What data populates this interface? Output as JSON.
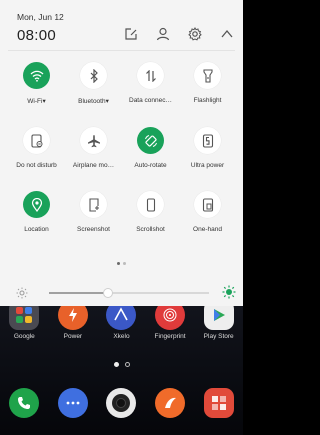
{
  "header": {
    "date": "Mon, Jun 12",
    "time": "08:00",
    "icons": [
      "edit-icon",
      "user-icon",
      "settings-icon",
      "collapse-icon"
    ]
  },
  "quick_settings": [
    {
      "label": "Wi-Fi▾",
      "icon": "wifi-icon",
      "active": true
    },
    {
      "label": "Bluetooth▾",
      "icon": "bluetooth-icon",
      "active": false
    },
    {
      "label": "Data connec…",
      "icon": "data-icon",
      "active": false
    },
    {
      "label": "Flashlight",
      "icon": "flashlight-icon",
      "active": false
    },
    {
      "label": "Do not disturb",
      "icon": "dnd-icon",
      "active": false
    },
    {
      "label": "Airplane mo…",
      "icon": "airplane-icon",
      "active": false
    },
    {
      "label": "Auto-rotate",
      "icon": "rotate-icon",
      "active": true
    },
    {
      "label": "Ultra power",
      "icon": "power-save-icon",
      "active": false
    },
    {
      "label": "Location",
      "icon": "location-icon",
      "active": true
    },
    {
      "label": "Screenshot",
      "icon": "screenshot-icon",
      "active": false
    },
    {
      "label": "Scrollshot",
      "icon": "scrollshot-icon",
      "active": false
    },
    {
      "label": "One-hand",
      "icon": "one-hand-icon",
      "active": false
    }
  ],
  "qs_pages": {
    "count": 2,
    "active": 0
  },
  "brightness": {
    "level": 0.37
  },
  "home_apps": [
    {
      "label": "Google",
      "color": "#4a4a52"
    },
    {
      "label": "Power",
      "color": "#e8612a"
    },
    {
      "label": "Xkelo",
      "color": "#3b58c7"
    },
    {
      "label": "Fingerprint",
      "color": "#e03b3b"
    },
    {
      "label": "Play Store",
      "color": "#eeeeee"
    }
  ],
  "home_pages": {
    "count": 2,
    "active": 0
  },
  "dock": [
    {
      "icon": "phone-icon",
      "color": "#1fa34a"
    },
    {
      "icon": "messages-icon",
      "color": "#3f6fe0"
    },
    {
      "icon": "camera-icon",
      "color": "#e9e9e9"
    },
    {
      "icon": "browser-icon",
      "color": "#f06b2a"
    },
    {
      "icon": "gallery-icon",
      "color": "#e14a3a"
    }
  ],
  "colors": {
    "accent": "#19a25a",
    "shade_bg": "#f4f4f4"
  }
}
